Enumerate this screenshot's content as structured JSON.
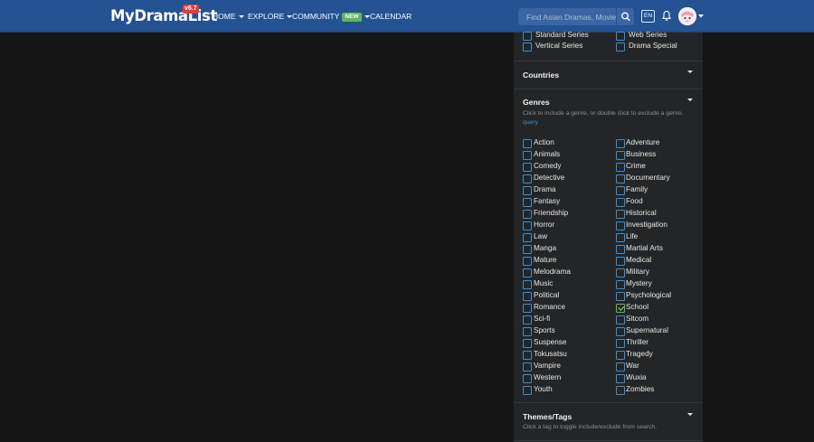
{
  "header": {
    "logo_text": "MyDramaList",
    "logo_version": "v6.7",
    "nav": [
      {
        "label": "HOME",
        "has_caret": true
      },
      {
        "label": "EXPLORE",
        "has_caret": true
      },
      {
        "label": "COMMUNITY",
        "badge": "NEW",
        "has_caret": true
      },
      {
        "label": "CALENDAR",
        "has_caret": false
      }
    ],
    "search_placeholder": "Find Asian Dramas, Movies",
    "language": "EN",
    "icons": [
      "search-icon",
      "bell-icon",
      "avatar",
      "chevron-down-icon"
    ]
  },
  "filters": {
    "type_options": [
      {
        "label": "Standard Series",
        "checked": false
      },
      {
        "label": "Web Series",
        "checked": false
      },
      {
        "label": "Vertical Series",
        "checked": false
      },
      {
        "label": "Drama Special",
        "checked": false
      }
    ],
    "countries_title": "Countries",
    "genres": {
      "title": "Genres",
      "hint": "Click to include a genre, or double click to exclude a genre.",
      "link": "query",
      "left": [
        {
          "label": "Action",
          "checked": false
        },
        {
          "label": "Animals",
          "checked": false
        },
        {
          "label": "Comedy",
          "checked": false
        },
        {
          "label": "Detective",
          "checked": false
        },
        {
          "label": "Drama",
          "checked": false
        },
        {
          "label": "Fantasy",
          "checked": false
        },
        {
          "label": "Friendship",
          "checked": false
        },
        {
          "label": "Horror",
          "checked": false
        },
        {
          "label": "Law",
          "checked": false
        },
        {
          "label": "Manga",
          "checked": false
        },
        {
          "label": "Mature",
          "checked": false
        },
        {
          "label": "Melodrama",
          "checked": false
        },
        {
          "label": "Music",
          "checked": false
        },
        {
          "label": "Political",
          "checked": false
        },
        {
          "label": "Romance",
          "checked": false
        },
        {
          "label": "Sci-fi",
          "checked": false
        },
        {
          "label": "Sports",
          "checked": false
        },
        {
          "label": "Suspense",
          "checked": false
        },
        {
          "label": "Tokusatsu",
          "checked": false
        },
        {
          "label": "Vampire",
          "checked": false
        },
        {
          "label": "Western",
          "checked": false
        },
        {
          "label": "Youth",
          "checked": false
        }
      ],
      "right": [
        {
          "label": "Adventure",
          "checked": false
        },
        {
          "label": "Business",
          "checked": false
        },
        {
          "label": "Crime",
          "checked": false
        },
        {
          "label": "Documentary",
          "checked": false
        },
        {
          "label": "Family",
          "checked": false
        },
        {
          "label": "Food",
          "checked": false
        },
        {
          "label": "Historical",
          "checked": false
        },
        {
          "label": "Investigation",
          "checked": false
        },
        {
          "label": "Life",
          "checked": false
        },
        {
          "label": "Martial Arts",
          "checked": false
        },
        {
          "label": "Medical",
          "checked": false
        },
        {
          "label": "Military",
          "checked": false
        },
        {
          "label": "Mystery",
          "checked": false
        },
        {
          "label": "Psychological",
          "checked": false
        },
        {
          "label": "School",
          "checked": true
        },
        {
          "label": "Sitcom",
          "checked": false
        },
        {
          "label": "Supernatural",
          "checked": false
        },
        {
          "label": "Thriller",
          "checked": false
        },
        {
          "label": "Tragedy",
          "checked": false
        },
        {
          "label": "War",
          "checked": false
        },
        {
          "label": "Wuxia",
          "checked": false
        },
        {
          "label": "Zombies",
          "checked": false
        }
      ]
    },
    "themes": {
      "title": "Themes/Tags",
      "hint": "Click a tag to toggle include/exclude from search."
    }
  },
  "colors": {
    "navbar": "#245292",
    "page_bg": "#161616",
    "panel_bg": "#242526",
    "checkbox_border": "#3c8fd6",
    "checked_color": "#66bb4c",
    "link": "#3e8ed2"
  }
}
